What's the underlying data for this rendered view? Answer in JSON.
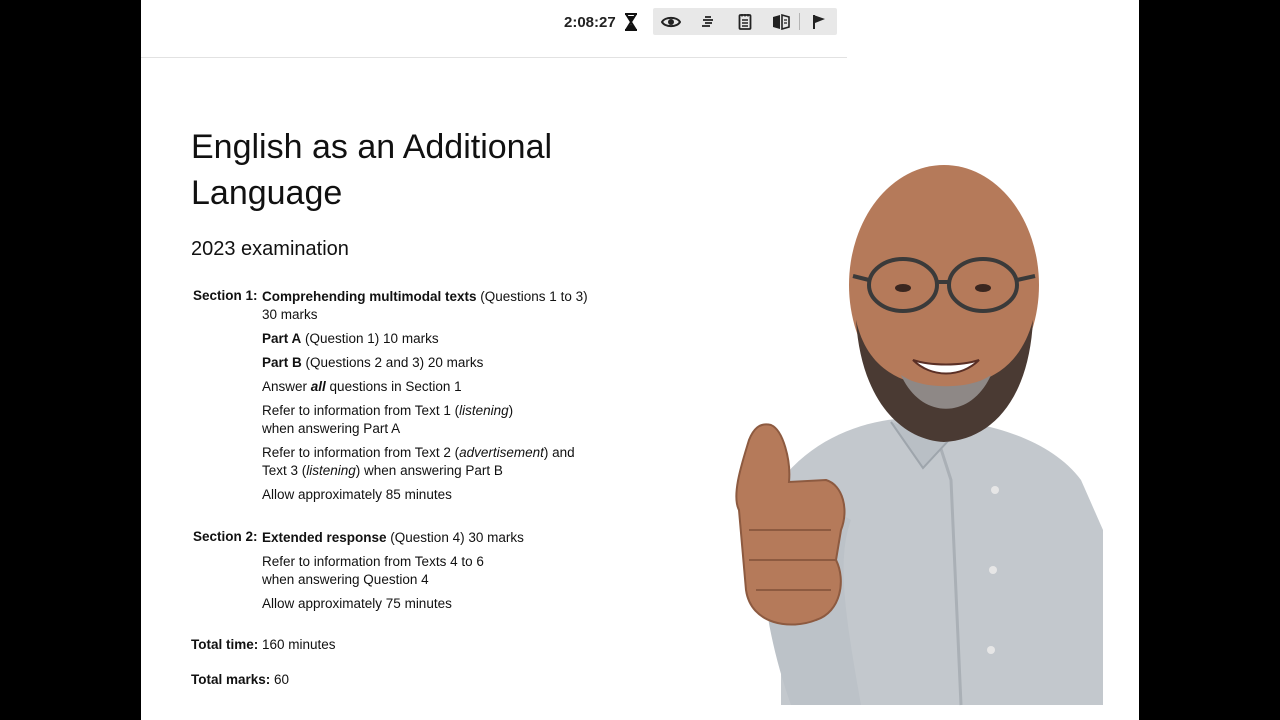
{
  "topbar": {
    "timer": "2:08:27",
    "tools": [
      "eye-icon",
      "line-reader-icon",
      "notepad-icon",
      "book-icon",
      "flag-icon"
    ]
  },
  "exam": {
    "title": "English as an Additional Language",
    "subtitle": "2023 examination",
    "section1": {
      "label": "Section 1:",
      "heading": "Comprehending multimodal texts",
      "heading_rest": " (Questions 1 to 3)",
      "marks": "30 marks",
      "partA_bold": "Part A",
      "partA_rest": " (Question 1) 10 marks",
      "partB_bold": "Part B",
      "partB_rest": " (Questions 2 and 3) 20 marks",
      "answer_pre": "Answer ",
      "answer_em": "all",
      "answer_post": " questions in Section 1",
      "ref1_pre": "Refer to information from Text 1 (",
      "ref1_em": "listening",
      "ref1_post": ")",
      "ref1_line2": "when answering Part A",
      "ref2_pre": "Refer to information from Text 2 (",
      "ref2_em": "advertisement",
      "ref2_post": ") and",
      "ref2_line2_pre": "Text 3 (",
      "ref2_line2_em": "listening",
      "ref2_line2_post": ") when answering Part B",
      "time": "Allow approximately 85 minutes"
    },
    "section2": {
      "label": "Section 2:",
      "heading": "Extended response",
      "heading_rest": " (Question 4) 30 marks",
      "ref_line1": "Refer to information from Texts 4 to 6",
      "ref_line2": "when answering Question 4",
      "time": "Allow approximately 75 minutes"
    },
    "total_time_label": "Total time:",
    "total_time_value": " 160 minutes",
    "total_marks_label": "Total marks:",
    "total_marks_value": " 60"
  },
  "colors": {
    "toolbar_bg": "#e8e8e8",
    "shirt": "#c3c8cd",
    "skin": "#b57a5a"
  }
}
